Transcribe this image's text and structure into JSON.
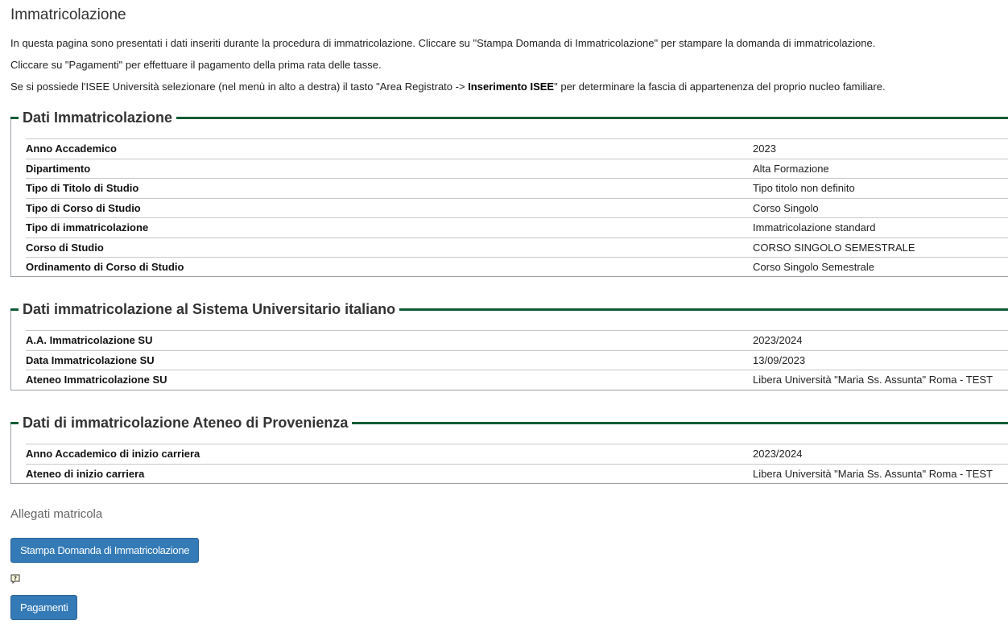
{
  "page": {
    "title": "Immatricolazione",
    "intro": {
      "line1": "In questa pagina sono presentati i dati inseriti durante la procedura di immatricolazione. Cliccare su \"Stampa Domanda di Immatricolazione\" per stampare la domanda di immatricolazione.",
      "line2": "Cliccare su \"Pagamenti\" per effettuare il pagamento della prima rata delle tasse.",
      "line3_pre": "Se si possiede l'ISEE Università selezionare (nel menù in alto a destra) il tasto \"Area Registrato -> ",
      "line3_bold": "Inserimento ISEE",
      "line3_post": "\" per determinare la fascia di appartenenza del proprio nucleo familiare."
    }
  },
  "sections": [
    {
      "title": "Dati Immatricolazione",
      "rows": [
        {
          "label": "Anno Accademico",
          "value": "2023"
        },
        {
          "label": "Dipartimento",
          "value": "Alta Formazione"
        },
        {
          "label": "Tipo di Titolo di Studio",
          "value": "Tipo titolo non definito"
        },
        {
          "label": "Tipo di Corso di Studio",
          "value": "Corso Singolo"
        },
        {
          "label": "Tipo di immatricolazione",
          "value": "Immatricolazione standard"
        },
        {
          "label": "Corso di Studio",
          "value": "CORSO SINGOLO SEMESTRALE"
        },
        {
          "label": "Ordinamento di Corso di Studio",
          "value": "Corso Singolo Semestrale"
        }
      ]
    },
    {
      "title": "Dati immatricolazione al Sistema Universitario italiano",
      "rows": [
        {
          "label": "A.A. Immatricolazione SU",
          "value": "2023/2024"
        },
        {
          "label": "Data Immatricolazione SU",
          "value": "13/09/2023"
        },
        {
          "label": "Ateneo Immatricolazione SU",
          "value": "Libera Università \"Maria Ss. Assunta\" Roma - TEST"
        }
      ]
    },
    {
      "title": "Dati di immatricolazione Ateneo di Provenienza",
      "rows": [
        {
          "label": "Anno Accademico di inizio carriera",
          "value": "2023/2024"
        },
        {
          "label": "Ateneo di inizio carriera",
          "value": "Libera Università \"Maria Ss. Assunta\" Roma - TEST"
        }
      ]
    }
  ],
  "attachments": {
    "title": "Allegati matricola",
    "print_button": "Stampa Domanda di Immatricolazione",
    "help_icon": "help-icon",
    "payments_button": "Pagamenti"
  },
  "colors": {
    "accent_green": "#0e5c36",
    "button_blue": "#337ab7"
  }
}
